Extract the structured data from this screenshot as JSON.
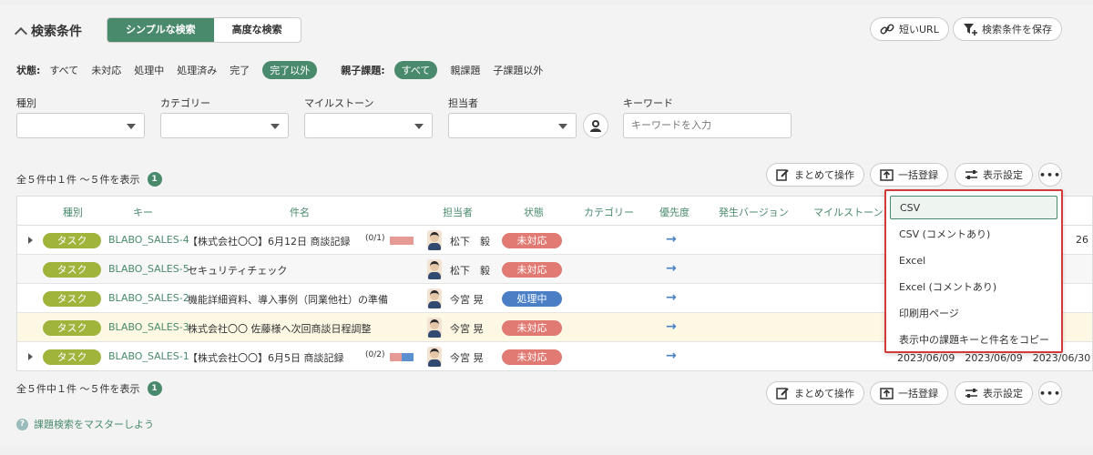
{
  "header": {
    "title": "検索条件",
    "simple_tab": "シンプルな検索",
    "advanced_tab": "高度な検索",
    "short_url": "短いURL",
    "save_search": "検索条件を保存"
  },
  "filters": {
    "status_label": "状態:",
    "status_options": [
      "すべて",
      "未対応",
      "処理中",
      "処理済み",
      "完了",
      "完了以外"
    ],
    "parent_label": "親子課題:",
    "parent_options": [
      "すべて",
      "親課題",
      "子課題以外"
    ],
    "type_label": "種別",
    "category_label": "カテゴリー",
    "milestone_label": "マイルストーン",
    "assignee_label": "担当者",
    "keyword_label": "キーワード",
    "keyword_placeholder": "キーワードを入力"
  },
  "results": {
    "count_text": "全５件中１件 〜５件を表示",
    "page": "1",
    "bulk_action": "まとめて操作",
    "bulk_register": "一括登録",
    "display_settings": "表示設定",
    "more": "•••"
  },
  "table": {
    "headers": {
      "type": "種別",
      "key": "キー",
      "subject": "件名",
      "assignee": "担当者",
      "status": "状態",
      "category": "カテゴリー",
      "priority": "優先度",
      "version": "発生バージョン",
      "milestone": "マイルストーン"
    },
    "rows": [
      {
        "type": "タスク",
        "key": "BLABO_SALES-4",
        "subject": "【株式会社〇〇】6月12日 商談記録",
        "progress": "(0/1)",
        "assignee": "松下　毅",
        "status": "未対応",
        "priority": "→",
        "date": "26"
      },
      {
        "type": "タスク",
        "key": "BLABO_SALES-5",
        "subject": "セキュリティチェック",
        "progress": "",
        "assignee": "松下　毅",
        "status": "未対応",
        "priority": "→",
        "date": ""
      },
      {
        "type": "タスク",
        "key": "BLABO_SALES-2",
        "subject": "機能詳細資料、導入事例（同業他社）の準備",
        "progress": "",
        "assignee": "今宮 晃",
        "status": "処理中",
        "priority": "→",
        "date": ""
      },
      {
        "type": "タスク",
        "key": "BLABO_SALES-3",
        "subject": "株式会社〇〇 佐藤様へ次回商談日程調整",
        "progress": "",
        "assignee": "今宮 晃",
        "status": "未対応",
        "priority": "→",
        "date": ""
      },
      {
        "type": "タスク",
        "key": "BLABO_SALES-1",
        "subject": "【株式会社〇〇】6月5日 商談記録",
        "progress": "(0/2)",
        "assignee": "今宮 晃",
        "status": "未対応",
        "priority": "→",
        "date": "2023/06/09　2023/06/09　2023/06/30"
      }
    ]
  },
  "export_menu": {
    "items": [
      "CSV",
      "CSV (コメントあり)",
      "Excel",
      "Excel (コメントあり)",
      "印刷用ページ",
      "表示中の課題キーと件名をコピー"
    ]
  },
  "help": {
    "text": "課題検索をマスターしよう",
    "icon_glyph": "?"
  },
  "colors": {
    "accent": "#4a8a6c",
    "type_badge": "#a0b43c",
    "status_open": "#e07a72",
    "status_progress": "#4a7fc6",
    "menu_border": "#d33a3a"
  }
}
